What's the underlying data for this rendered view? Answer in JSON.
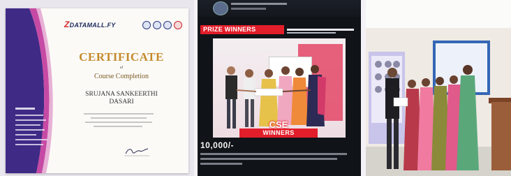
{
  "panels": {
    "certificate": {
      "logo_prefix": "Z",
      "logo_text": "DATAMALL.FY",
      "title": "CERTIFICATE",
      "of_text": "of",
      "subtitle": "Course Completion",
      "name_line1": "SRUJANA SANKEERTHI",
      "name_line2": "DASARI",
      "colors": {
        "band_purple": "#3f2a86",
        "band_pink": "#c64aa4",
        "gold": "#c48a2c"
      }
    },
    "prize": {
      "banner": "PRIZE WINNERS",
      "cse": "CSE",
      "winners": "WINNERS",
      "amount": "10,000/-",
      "colors": {
        "accent_red": "#e21e2a"
      }
    },
    "event": {
      "colors": {
        "screen_blue": "#3567b4",
        "podium": "#9a5e3a"
      }
    }
  }
}
